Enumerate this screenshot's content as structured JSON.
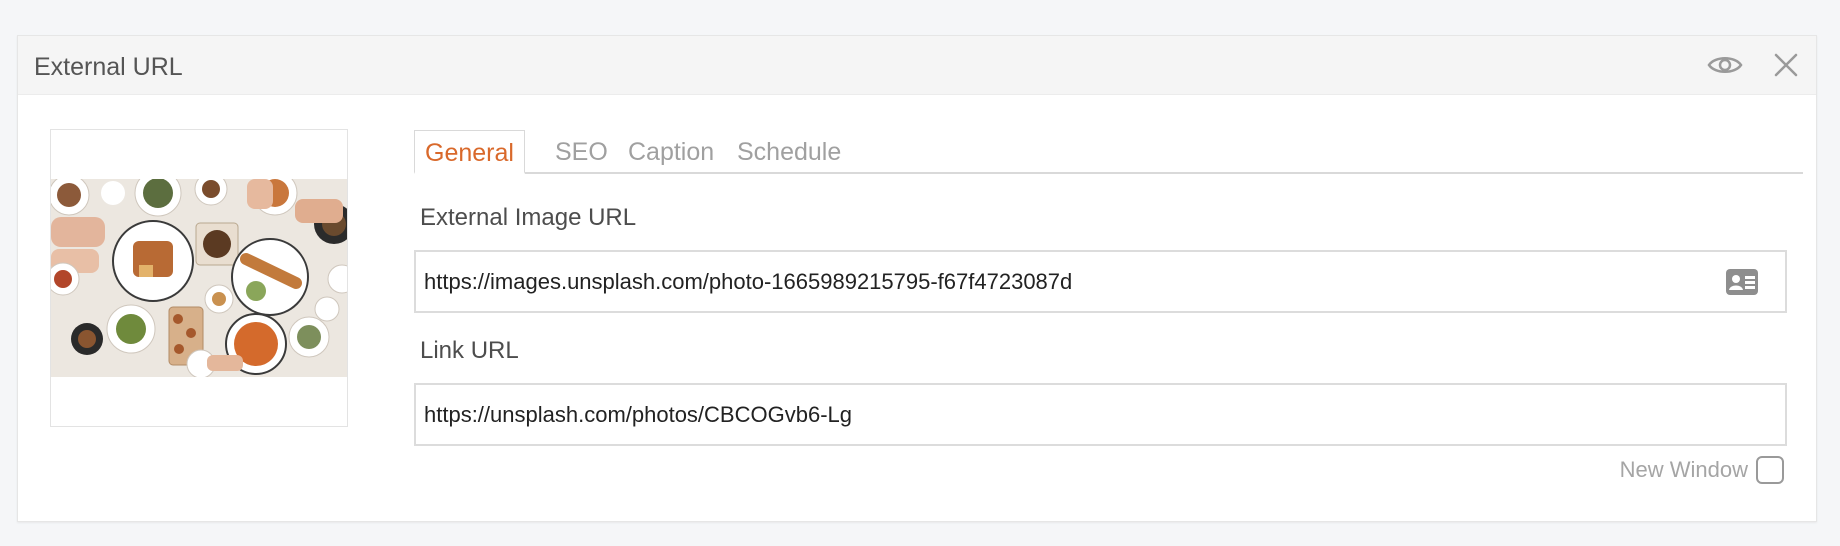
{
  "panel": {
    "title": "External URL",
    "header_icons": [
      "eye-icon",
      "close-icon"
    ]
  },
  "tabs": [
    {
      "label": "General",
      "active": true
    },
    {
      "label": "SEO",
      "active": false
    },
    {
      "label": "Caption",
      "active": false
    },
    {
      "label": "Schedule",
      "active": false
    }
  ],
  "form": {
    "external_image_url": {
      "label": "External Image URL",
      "value": "https://images.unsplash.com/photo-1665989215795-f67f4723087d",
      "icon": "id-card-icon"
    },
    "link_url": {
      "label": "Link URL",
      "value": "https://unsplash.com/photos/CBCOGvb6-Lg"
    },
    "new_window": {
      "label": "New Window",
      "checked": false
    }
  },
  "colors": {
    "accent": "#d9692b",
    "header_bg": "#f5f5f5",
    "page_bg": "#f5f6f8"
  }
}
